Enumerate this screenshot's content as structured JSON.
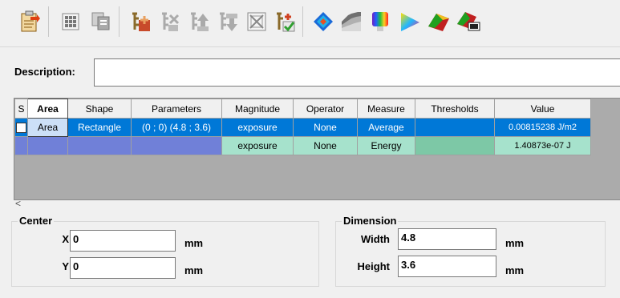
{
  "toolbar": {
    "buttons": [
      {
        "name": "import-icon"
      },
      {
        "name": "grid-icon"
      },
      {
        "name": "copy-icon"
      },
      {
        "name": "add-measure-icon"
      },
      {
        "name": "remove-measure-icon"
      },
      {
        "name": "move-up-icon"
      },
      {
        "name": "move-down-icon"
      },
      {
        "name": "clear-icon"
      },
      {
        "name": "validate-icon"
      },
      {
        "name": "color-map-icon"
      },
      {
        "name": "histogram-icon"
      },
      {
        "name": "spectrum-icon"
      },
      {
        "name": "color-triangle-icon"
      },
      {
        "name": "surface-3d-icon"
      },
      {
        "name": "surface-display-icon"
      }
    ]
  },
  "description": {
    "label": "Description:",
    "value": ""
  },
  "table": {
    "columns": [
      "S",
      "Area",
      "Shape",
      "Parameters",
      "Magnitude",
      "Operator",
      "Measure",
      "Thresholds",
      "Value"
    ],
    "rows": [
      {
        "s": "",
        "area": "Area",
        "shape": "Rectangle",
        "parameters": "(0 ; 0) (4.8 ; 3.6)",
        "magnitude": "exposure",
        "operator": "None",
        "measure": "Average",
        "thresholds": "",
        "value": "0.00815238 J/m2"
      },
      {
        "s": "",
        "area": "",
        "shape": "",
        "parameters": "",
        "magnitude": "exposure",
        "operator": "None",
        "measure": "Energy",
        "thresholds": "",
        "value": "1.40873e-07 J"
      }
    ]
  },
  "scroll": {
    "left_arrow": "<"
  },
  "center": {
    "title": "Center",
    "x_label": "X",
    "x_value": "0",
    "y_label": "Y",
    "y_value": "0",
    "unit": "mm"
  },
  "dimension": {
    "title": "Dimension",
    "width_label": "Width",
    "width_value": "4.8",
    "height_label": "Height",
    "height_value": "3.6",
    "unit": "mm"
  }
}
